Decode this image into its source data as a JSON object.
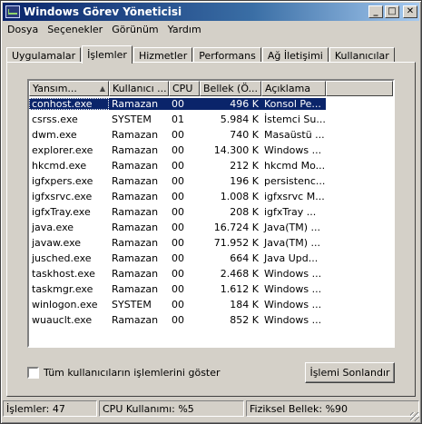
{
  "window": {
    "title": "Windows Görev Yöneticisi",
    "controls": {
      "minimize": "_",
      "maximize": "□",
      "close": "✕"
    }
  },
  "menu": [
    {
      "label": "Dosya"
    },
    {
      "label": "Seçenekler"
    },
    {
      "label": "Görünüm"
    },
    {
      "label": "Yardım"
    }
  ],
  "tabs": [
    {
      "label": "Uygulamalar",
      "active": false
    },
    {
      "label": "İşlemler",
      "active": true
    },
    {
      "label": "Hizmetler",
      "active": false
    },
    {
      "label": "Performans",
      "active": false
    },
    {
      "label": "Ağ İletişimi",
      "active": false
    },
    {
      "label": "Kullanıcılar",
      "active": false
    }
  ],
  "processes": {
    "columns": [
      "Yansım...",
      "Kullanıcı ...",
      "CPU",
      "Bellek (Ö...",
      "Açıklama"
    ],
    "sort_indicator": "▲",
    "rows": [
      {
        "image": "conhost.exe",
        "user": "Ramazan",
        "cpu": "00",
        "memory": "496 K",
        "description": "Konsol Pe...",
        "selected": true
      },
      {
        "image": "csrss.exe",
        "user": "SYSTEM",
        "cpu": "01",
        "memory": "5.984 K",
        "description": "İstemci Su..."
      },
      {
        "image": "dwm.exe",
        "user": "Ramazan",
        "cpu": "00",
        "memory": "740 K",
        "description": "Masaüstü ..."
      },
      {
        "image": "explorer.exe",
        "user": "Ramazan",
        "cpu": "00",
        "memory": "14.300 K",
        "description": "Windows ..."
      },
      {
        "image": "hkcmd.exe",
        "user": "Ramazan",
        "cpu": "00",
        "memory": "212 K",
        "description": "hkcmd Mo..."
      },
      {
        "image": "igfxpers.exe",
        "user": "Ramazan",
        "cpu": "00",
        "memory": "196 K",
        "description": "persistenc..."
      },
      {
        "image": "igfxsrvc.exe",
        "user": "Ramazan",
        "cpu": "00",
        "memory": "1.008 K",
        "description": "igfxsrvc M..."
      },
      {
        "image": "igfxTray.exe",
        "user": "Ramazan",
        "cpu": "00",
        "memory": "208 K",
        "description": "igfxTray ..."
      },
      {
        "image": "java.exe",
        "user": "Ramazan",
        "cpu": "00",
        "memory": "16.724 K",
        "description": "Java(TM) ..."
      },
      {
        "image": "javaw.exe",
        "user": "Ramazan",
        "cpu": "00",
        "memory": "71.952 K",
        "description": "Java(TM) ..."
      },
      {
        "image": "jusched.exe",
        "user": "Ramazan",
        "cpu": "00",
        "memory": "664 K",
        "description": "Java Upd..."
      },
      {
        "image": "taskhost.exe",
        "user": "Ramazan",
        "cpu": "00",
        "memory": "2.468 K",
        "description": "Windows ..."
      },
      {
        "image": "taskmgr.exe",
        "user": "Ramazan",
        "cpu": "00",
        "memory": "1.612 K",
        "description": "Windows ..."
      },
      {
        "image": "winlogon.exe",
        "user": "SYSTEM",
        "cpu": "00",
        "memory": "184 K",
        "description": "Windows ..."
      },
      {
        "image": "wuauclt.exe",
        "user": "Ramazan",
        "cpu": "00",
        "memory": "852 K",
        "description": "Windows ..."
      }
    ]
  },
  "show_all_users": {
    "label": "Tüm kullanıcıların işlemlerini göster",
    "checked": false
  },
  "end_process_button": "İşlemi Sonlandır",
  "status": {
    "processes": "İşlemler: 47",
    "cpu": "CPU Kullanımı: %5",
    "memory": "Fiziksel Bellek: %90"
  }
}
